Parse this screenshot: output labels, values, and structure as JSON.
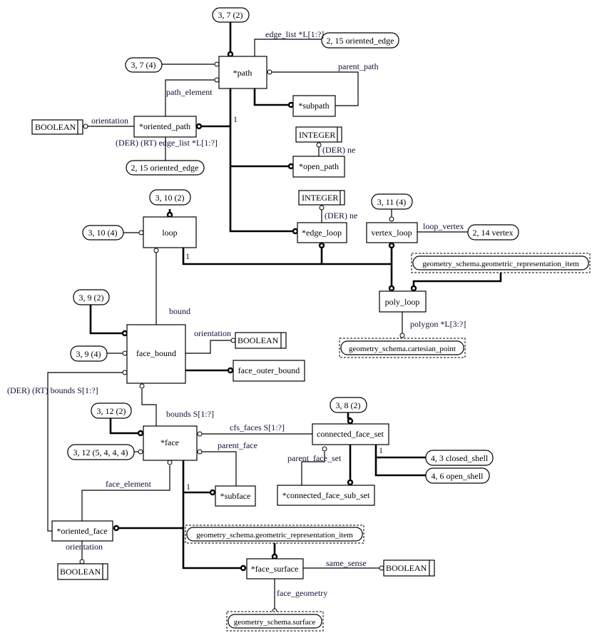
{
  "entities": {
    "path": "*path",
    "subpath": "*subpath",
    "oriented_path": "*oriented_path",
    "open_path": "*open_path",
    "edge_loop": "*edge_loop",
    "vertex_loop": "vertex_loop",
    "loop": "loop",
    "poly_loop": "poly_loop",
    "face_bound": "face_bound",
    "face_outer_bound": "face_outer_bound",
    "face": "*face",
    "subface": "*subface",
    "oriented_face": "*oriented_face",
    "face_surface": "*face_surface",
    "connected_face_set": "connected_face_set",
    "connected_face_sub_set": "*connected_face_sub_set"
  },
  "types": {
    "boolean_1": "BOOLEAN",
    "boolean_2": "BOOLEAN",
    "boolean_3": "BOOLEAN",
    "boolean_4": "BOOLEAN",
    "integer_1": "INTEGER",
    "integer_2": "INTEGER"
  },
  "page_refs": {
    "r_3_7_2": "3, 7 (2)",
    "r_3_7_4": "3, 7 (4)",
    "r_2_15_a": "2, 15 oriented_edge",
    "r_2_15_b": "2, 15 oriented_edge",
    "r_3_10_2": "3, 10 (2)",
    "r_3_10_4": "3, 10 (4)",
    "r_3_11_4": "3, 11 (4)",
    "r_2_14": "2, 14 vertex",
    "r_3_9_2": "3, 9 (2)",
    "r_3_9_4": "3, 9 (4)",
    "r_3_12_2": "3, 12 (2)",
    "r_3_12_5444": "3, 12 (5, 4, 4, 4)",
    "r_3_8_2": "3, 8 (2)",
    "r_4_3": "4, 3 closed_shell",
    "r_4_6": "4, 6 open_shell"
  },
  "schema_refs": {
    "gri_1": "geometry_schema.geometric_representation_item",
    "gri_2": "geometry_schema.geometric_representation_item",
    "cartesian_point": "geometry_schema.cartesian_point",
    "surface": "geometry_schema.surface"
  },
  "attributes": {
    "edge_list": "edge_list *L[1:?]",
    "parent_path": "parent_path",
    "path_element": "path_element",
    "orientation_path": "orientation",
    "der_rt_edge_list": "(DER) (RT) edge_list *L[1:?]",
    "der_ne_1": "(DER) ne",
    "der_ne_2": "(DER) ne",
    "loop_vertex": "loop_vertex",
    "polygon": "polygon *L[3:?]",
    "bound": "bound",
    "orientation_bound": "orientation",
    "der_rt_bounds": "(DER) (RT) bounds S[1:?]",
    "bounds": "bounds S[1:?]",
    "cfs_faces": "cfs_faces S[1:?]",
    "parent_face": "parent_face",
    "parent_face_set": "parent_face_set",
    "face_element": "face_element",
    "orientation_face": "orientation",
    "same_sense": "same_sense",
    "face_geometry": "face_geometry"
  },
  "cardinality": {
    "path_one": "1",
    "loop_one": "1",
    "face_one": "1",
    "cfs_one": "1"
  }
}
